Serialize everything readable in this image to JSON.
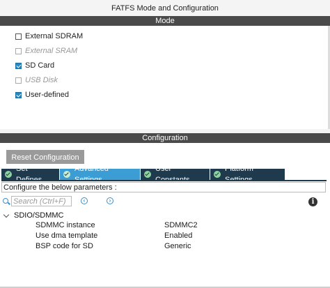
{
  "window": {
    "title": "FATFS Mode and Configuration"
  },
  "mode": {
    "header": "Mode",
    "options": [
      {
        "label": "External SDRAM",
        "checked": false,
        "disabled": false
      },
      {
        "label": "External SRAM",
        "checked": false,
        "disabled": true
      },
      {
        "label": "SD Card",
        "checked": true,
        "disabled": false
      },
      {
        "label": "USB Disk",
        "checked": false,
        "disabled": true
      },
      {
        "label": "User-defined",
        "checked": true,
        "disabled": false
      }
    ]
  },
  "configuration": {
    "header": "Configuration",
    "reset_label": "Reset Configuration",
    "tabs": [
      {
        "label": "Set Defines",
        "active": false
      },
      {
        "label": "Advanced Settings",
        "active": true
      },
      {
        "label": "User Constants",
        "active": false
      },
      {
        "label": "Platform Settings",
        "active": false
      }
    ],
    "params_caption": "Configure the below parameters :",
    "search": {
      "placeholder": "Search (Ctrl+F)",
      "value": ""
    },
    "group": {
      "label": "SDIO/SDMMC",
      "rows": [
        {
          "name": "SDMMC instance",
          "value": "SDMMC2"
        },
        {
          "name": "Use dma template",
          "value": "Enabled"
        },
        {
          "name": "BSP code for SD",
          "value": "Generic"
        }
      ]
    }
  },
  "colors": {
    "header_bar": "#4a4a4a",
    "tab_bg": "#1f3a4d",
    "tab_active": "#3b9dd4",
    "checkbox_checked": "#1e88c8"
  }
}
